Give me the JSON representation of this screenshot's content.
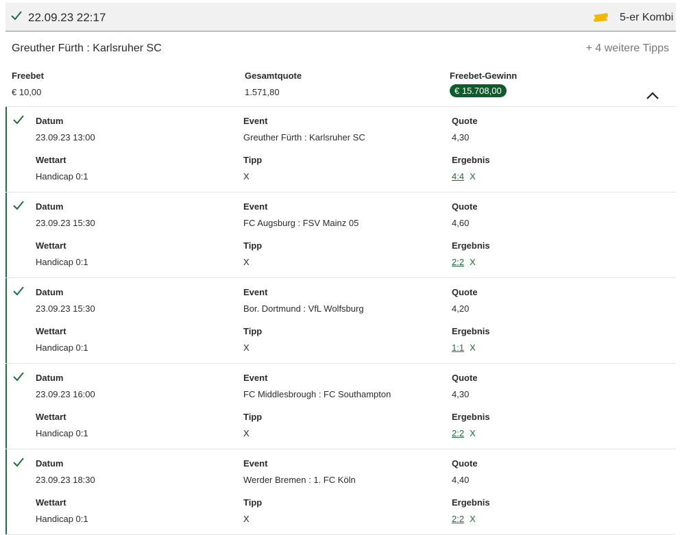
{
  "header": {
    "datetime": "22.09.23 22:17",
    "kombi_label": "5-er Kombi",
    "icons": {
      "status": "check-icon",
      "ticket": "ticket-icon"
    },
    "colors": {
      "check": "#1f6e3a",
      "ticket": "#f2b705"
    }
  },
  "summary": {
    "event_title": "Greuther Fürth : Karlsruher SC",
    "more_tips": "+ 4 weitere Tipps",
    "freebet_label": "Freebet",
    "freebet_value": "€ 10,00",
    "gesamtquote_label": "Gesamtquote",
    "gesamtquote_value": "1.571,80",
    "gewinn_label": "Freebet-Gewinn",
    "gewinn_value": "€ 15.708,00",
    "badge_color": "#0f5c2b"
  },
  "labels": {
    "datum": "Datum",
    "event": "Event",
    "quote": "Quote",
    "wettart": "Wettart",
    "tipp": "Tipp",
    "ergebnis": "Ergebnis"
  },
  "bets": [
    {
      "datum": "23.09.23 13:00",
      "event": "Greuther Fürth : Karlsruher SC",
      "quote": "4,30",
      "wettart": "Handicap 0:1",
      "tipp": "X",
      "score": "4:4",
      "result_tipp": "X"
    },
    {
      "datum": "23.09.23 15:30",
      "event": "FC Augsburg : FSV Mainz 05",
      "quote": "4,60",
      "wettart": "Handicap 0:1",
      "tipp": "X",
      "score": "2:2",
      "result_tipp": "X"
    },
    {
      "datum": "23.09.23 15:30",
      "event": "Bor. Dortmund : VfL Wolfsburg",
      "quote": "4,20",
      "wettart": "Handicap 0:1",
      "tipp": "X",
      "score": "1:1",
      "result_tipp": "X"
    },
    {
      "datum": "23.09.23 16:00",
      "event": "FC Middlesbrough : FC Southampton",
      "quote": "4,30",
      "wettart": "Handicap 0:1",
      "tipp": "X",
      "score": "2:2",
      "result_tipp": "X"
    },
    {
      "datum": "23.09.23 18:30",
      "event": "Werder Bremen : 1. FC Köln",
      "quote": "4,40",
      "wettart": "Handicap 0:1",
      "tipp": "X",
      "score": "2:2",
      "result_tipp": "X"
    }
  ]
}
